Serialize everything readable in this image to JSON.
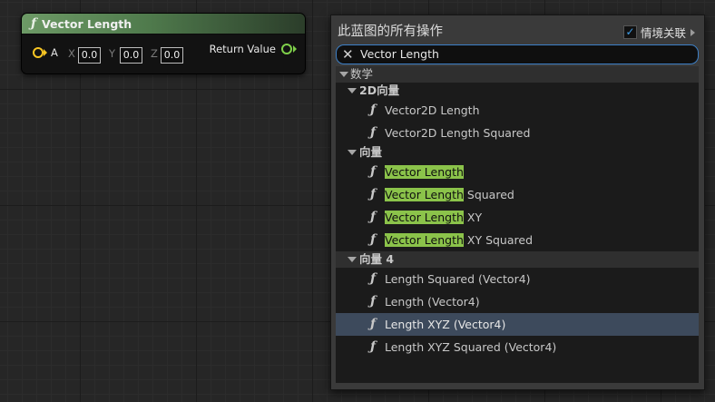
{
  "node": {
    "title": "Vector Length",
    "input_pin_label": "A",
    "components": [
      {
        "axis": "X",
        "value": "0.0"
      },
      {
        "axis": "Y",
        "value": "0.0"
      },
      {
        "axis": "Z",
        "value": "0.0"
      }
    ],
    "output_pin_label": "Return Value"
  },
  "menu": {
    "title": "此蓝图的所有操作",
    "context_sensitive_label": "情境关联",
    "context_sensitive_checked": true,
    "search_value": "Vector Length",
    "tree": [
      {
        "kind": "category",
        "level": 0,
        "label": "数学"
      },
      {
        "kind": "category",
        "level": 1,
        "label": "2D向量"
      },
      {
        "kind": "item",
        "label": "Vector2D Length",
        "highlight": ""
      },
      {
        "kind": "item",
        "label": "Vector2D Length Squared",
        "highlight": ""
      },
      {
        "kind": "category",
        "level": 1,
        "label": "向量"
      },
      {
        "kind": "item",
        "label": "Vector Length",
        "highlight": "Vector Length"
      },
      {
        "kind": "item",
        "label": "Vector Length Squared",
        "highlight": "Vector Length"
      },
      {
        "kind": "item",
        "label": "Vector Length XY",
        "highlight": "Vector Length"
      },
      {
        "kind": "item",
        "label": "Vector Length XY Squared",
        "highlight": "Vector Length"
      },
      {
        "kind": "category",
        "level": 1,
        "label": "向量 4"
      },
      {
        "kind": "item",
        "label": "Length Squared (Vector4)",
        "highlight": ""
      },
      {
        "kind": "item",
        "label": "Length (Vector4)",
        "highlight": ""
      },
      {
        "kind": "item",
        "label": "Length XYZ (Vector4)",
        "highlight": "",
        "selected": true
      },
      {
        "kind": "item",
        "label": "Length XYZ Squared (Vector4)",
        "highlight": ""
      }
    ]
  },
  "colors": {
    "node_header": "#5f8c5a",
    "float_pin": "#f7c523",
    "return_pin": "#7fd04a",
    "search_highlight": "#8bc34a",
    "selection": "#3d4a5c",
    "checkbox_accent": "#3e9ee8"
  },
  "icons": {
    "function": "function-icon",
    "clear_search": "close-icon",
    "expand": "triangle-down-icon",
    "checkbox": "check-icon",
    "context_arrow": "triangle-right-icon"
  }
}
